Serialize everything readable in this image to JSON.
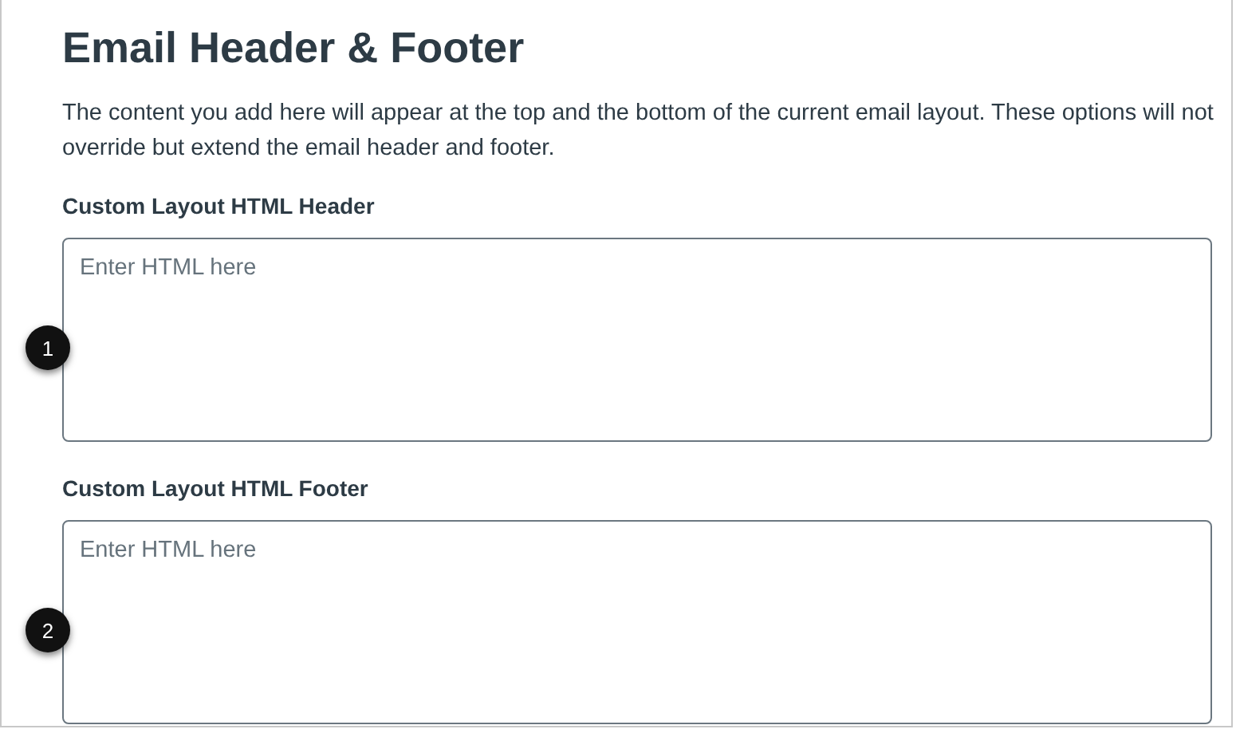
{
  "title": "Email Header & Footer",
  "description": "The content you add here will appear at the top and the bottom of the current email layout. These options will not override but extend the email header and footer.",
  "fields": [
    {
      "label": "Custom Layout HTML Header",
      "placeholder": "Enter HTML here",
      "callout": "1"
    },
    {
      "label": "Custom Layout HTML Footer",
      "placeholder": "Enter HTML here",
      "callout": "2"
    }
  ]
}
